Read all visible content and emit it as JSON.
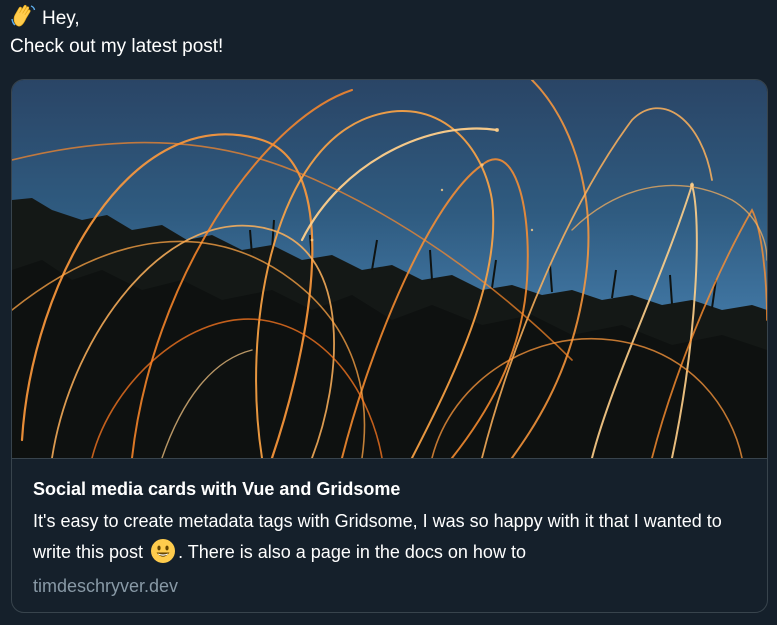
{
  "tweet": {
    "greeting": "Hey,",
    "wave_icon": "waving-hand-icon",
    "text": "Check out my latest post!"
  },
  "card": {
    "image_description_icon": "sparkler-light-trails-image",
    "title": "Social media cards with Vue and Gridsome",
    "description_part1": "It's easy to create metadata tags with Gridsome, I was so happy with it that I wanted to write this post",
    "smiley_icon": "grinning-face-icon",
    "description_part2": ". There is also a page in the docs on how to",
    "domain": "timdeschryver.dev"
  },
  "colors": {
    "background": "#15202b",
    "border": "#38444d",
    "text": "#ffffff",
    "muted": "#8899a6",
    "emoji_yellow": "#ffcc4d"
  }
}
